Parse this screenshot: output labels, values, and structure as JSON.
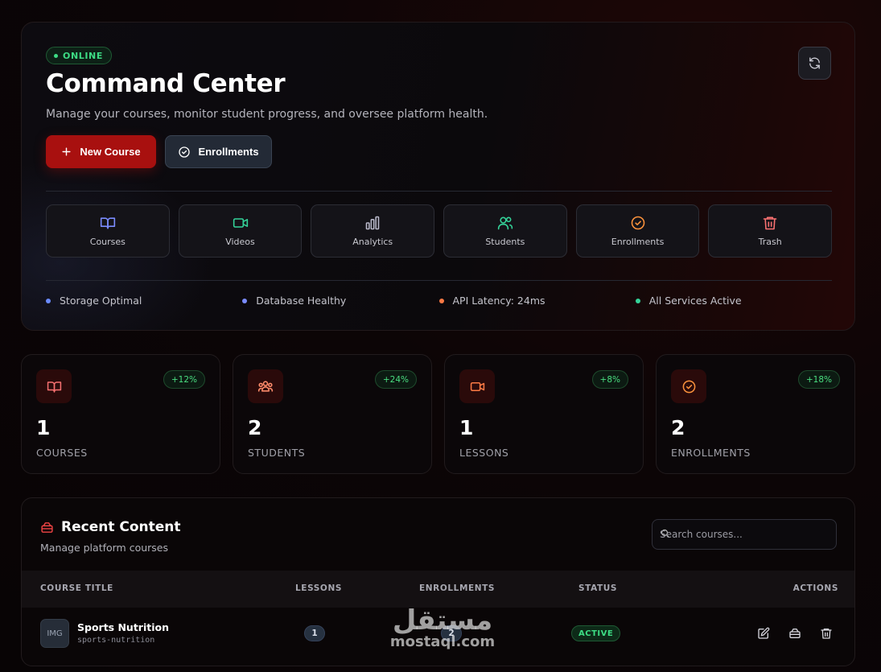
{
  "hero": {
    "status_badge": "ONLINE",
    "title": "Command Center",
    "subtitle": "Manage your courses, monitor student progress, and oversee platform health.",
    "primary_button": "New Course",
    "secondary_button": "Enrollments",
    "refresh_icon": "refresh-icon"
  },
  "quick_links": [
    {
      "label": "Courses",
      "icon": "book-icon",
      "color": "#7b8cff"
    },
    {
      "label": "Videos",
      "icon": "video-icon",
      "color": "#34d399"
    },
    {
      "label": "Analytics",
      "icon": "bar-chart-icon",
      "color": "#a1a1b5"
    },
    {
      "label": "Students",
      "icon": "users-icon",
      "color": "#34d399"
    },
    {
      "label": "Enrollments",
      "icon": "check-circle-icon",
      "color": "#fb923c"
    },
    {
      "label": "Trash",
      "icon": "trash-icon",
      "color": "#f87171"
    }
  ],
  "system_status": [
    {
      "label": "Storage Optimal",
      "color": "#6b8cff"
    },
    {
      "label": "Database Healthy",
      "color": "#7b8cff"
    },
    {
      "label": "API Latency: 24ms",
      "color": "#fb7a45"
    },
    {
      "label": "All Services Active",
      "color": "#34d399"
    }
  ],
  "stats": [
    {
      "value": "1",
      "label": "COURSES",
      "trend": "+12%",
      "icon": "book-icon"
    },
    {
      "value": "2",
      "label": "STUDENTS",
      "trend": "+24%",
      "icon": "users-group-icon"
    },
    {
      "value": "1",
      "label": "LESSONS",
      "trend": "+8%",
      "icon": "video-icon"
    },
    {
      "value": "2",
      "label": "ENROLLMENTS",
      "trend": "+18%",
      "icon": "check-circle-icon"
    }
  ],
  "recent": {
    "title": "Recent Content",
    "subtitle": "Manage platform courses",
    "search_placeholder": "Search courses...",
    "columns": [
      "COURSE TITLE",
      "LESSONS",
      "ENROLLMENTS",
      "STATUS",
      "ACTIONS"
    ],
    "rows": [
      {
        "thumb": "IMG",
        "title": "Sports Nutrition",
        "slug": "sports-nutrition",
        "lessons": "1",
        "enrollments": "2",
        "status": "ACTIVE"
      }
    ]
  },
  "watermark": {
    "arabic": "مستقل",
    "latin": "mostaql.com"
  },
  "colors": {
    "accent": "#a8100f",
    "success": "#3ddc84",
    "background": "#0b0506"
  }
}
